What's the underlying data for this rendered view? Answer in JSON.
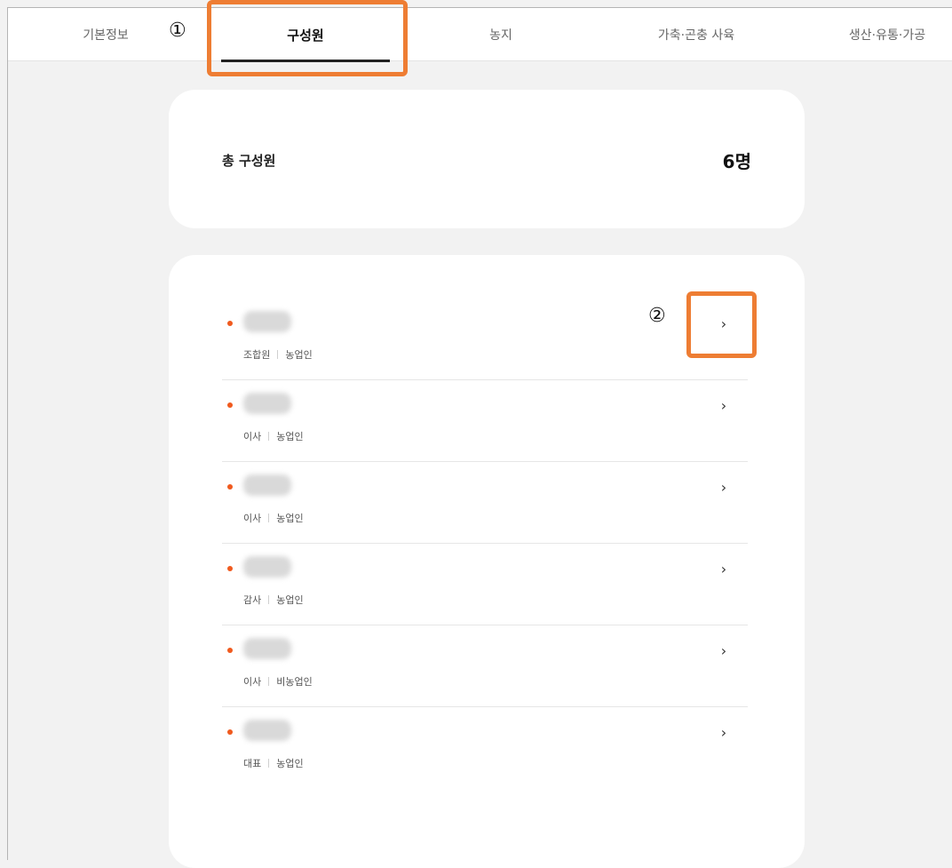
{
  "tabs": [
    {
      "label": "기본정보",
      "active": false
    },
    {
      "label": "구성원",
      "active": true
    },
    {
      "label": "농지",
      "active": false
    },
    {
      "label": "가축·곤충 사육",
      "active": false
    },
    {
      "label": "생산·유통·가공",
      "active": false
    }
  ],
  "annotations": {
    "one": "①",
    "two": "②"
  },
  "summary": {
    "label": "총 구성원",
    "value": "6명"
  },
  "members": [
    {
      "role": "조합원",
      "type": "농업인"
    },
    {
      "role": "이사",
      "type": "농업인"
    },
    {
      "role": "이사",
      "type": "농업인"
    },
    {
      "role": "감사",
      "type": "농업인"
    },
    {
      "role": "이사",
      "type": "비농업인"
    },
    {
      "role": "대표",
      "type": "농업인"
    }
  ],
  "icons": {
    "chevron": "chevron-right-icon",
    "bullet": "bullet-dot-icon"
  },
  "colors": {
    "annotation": "#ee7d33",
    "bullet": "#f05a1e",
    "background": "#f2f2f2"
  }
}
